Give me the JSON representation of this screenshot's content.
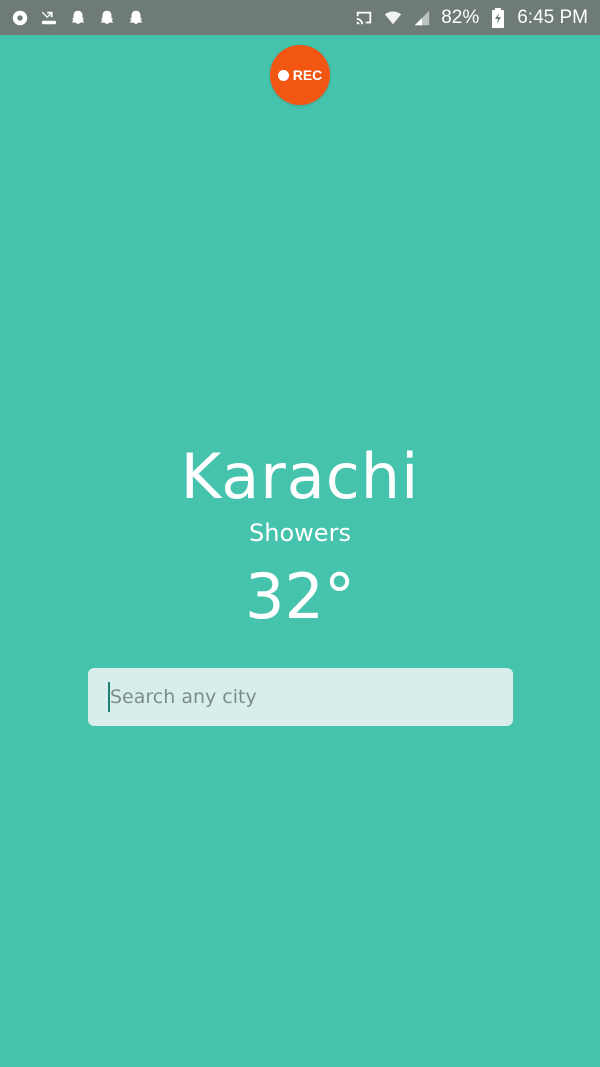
{
  "status_bar": {
    "left_icons": [
      "chrome-icon",
      "missed-call-icon",
      "snapchat-icon",
      "snapchat-icon",
      "snapchat-icon"
    ],
    "right_icons": [
      "cast-icon",
      "wifi-icon",
      "signal-icon"
    ],
    "battery": "82%",
    "time": "6:45 PM",
    "background": "#6e7b78"
  },
  "rec_button": {
    "label": "REC",
    "color": "#f25613"
  },
  "weather": {
    "city": "Karachi",
    "condition": "Showers",
    "temperature": "32°"
  },
  "search": {
    "placeholder": "Search any city",
    "value": ""
  },
  "colors": {
    "background": "#46c3ad",
    "search_box": "#d7eeea"
  }
}
